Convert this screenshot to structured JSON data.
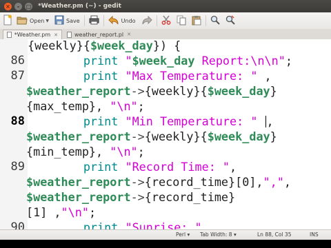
{
  "window": {
    "title": "*Weather.pm (~) - gedit",
    "controls": [
      "×",
      "–",
      "□"
    ]
  },
  "toolbar": {
    "open_label": "Open",
    "save_label": "Save",
    "undo_label": "Undo",
    "icons": [
      "new-document-icon",
      "open-folder-icon",
      "save-icon",
      "print-icon",
      "undo-icon",
      "redo-icon",
      "cut-icon",
      "copy-icon",
      "paste-icon",
      "search-icon",
      "replace-icon"
    ]
  },
  "tabs": [
    {
      "label": "*Weather.pm",
      "active": true
    },
    {
      "label": "weather_report.pl",
      "active": false
    }
  ],
  "editor": {
    "current_line": 88,
    "line_numbers": [
      "86",
      "87",
      "88",
      "89",
      "90"
    ]
  },
  "statusbar": {
    "language": "Perl",
    "tab_width": "Tab Width: 8",
    "position": "Ln 88, Col 35",
    "mode": "INS"
  },
  "colors": {
    "keyword": "#a52a2a",
    "function": "#008b8b",
    "string": "#d400d4",
    "variable": "#2e8b57"
  }
}
